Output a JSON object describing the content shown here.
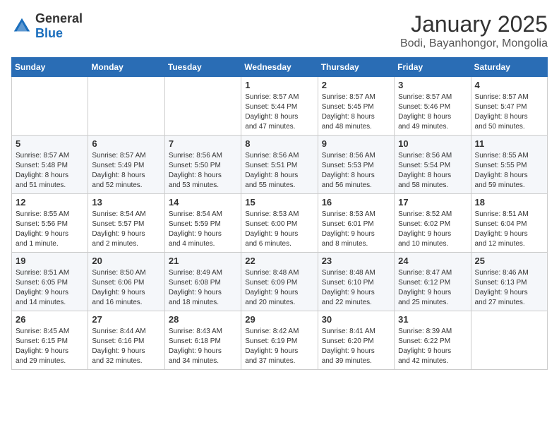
{
  "logo": {
    "general": "General",
    "blue": "Blue"
  },
  "header": {
    "month": "January 2025",
    "location": "Bodi, Bayanhongor, Mongolia"
  },
  "weekdays": [
    "Sunday",
    "Monday",
    "Tuesday",
    "Wednesday",
    "Thursday",
    "Friday",
    "Saturday"
  ],
  "weeks": [
    [
      {
        "day": "",
        "info": ""
      },
      {
        "day": "",
        "info": ""
      },
      {
        "day": "",
        "info": ""
      },
      {
        "day": "1",
        "info": "Sunrise: 8:57 AM\nSunset: 5:44 PM\nDaylight: 8 hours\nand 47 minutes."
      },
      {
        "day": "2",
        "info": "Sunrise: 8:57 AM\nSunset: 5:45 PM\nDaylight: 8 hours\nand 48 minutes."
      },
      {
        "day": "3",
        "info": "Sunrise: 8:57 AM\nSunset: 5:46 PM\nDaylight: 8 hours\nand 49 minutes."
      },
      {
        "day": "4",
        "info": "Sunrise: 8:57 AM\nSunset: 5:47 PM\nDaylight: 8 hours\nand 50 minutes."
      }
    ],
    [
      {
        "day": "5",
        "info": "Sunrise: 8:57 AM\nSunset: 5:48 PM\nDaylight: 8 hours\nand 51 minutes."
      },
      {
        "day": "6",
        "info": "Sunrise: 8:57 AM\nSunset: 5:49 PM\nDaylight: 8 hours\nand 52 minutes."
      },
      {
        "day": "7",
        "info": "Sunrise: 8:56 AM\nSunset: 5:50 PM\nDaylight: 8 hours\nand 53 minutes."
      },
      {
        "day": "8",
        "info": "Sunrise: 8:56 AM\nSunset: 5:51 PM\nDaylight: 8 hours\nand 55 minutes."
      },
      {
        "day": "9",
        "info": "Sunrise: 8:56 AM\nSunset: 5:53 PM\nDaylight: 8 hours\nand 56 minutes."
      },
      {
        "day": "10",
        "info": "Sunrise: 8:56 AM\nSunset: 5:54 PM\nDaylight: 8 hours\nand 58 minutes."
      },
      {
        "day": "11",
        "info": "Sunrise: 8:55 AM\nSunset: 5:55 PM\nDaylight: 8 hours\nand 59 minutes."
      }
    ],
    [
      {
        "day": "12",
        "info": "Sunrise: 8:55 AM\nSunset: 5:56 PM\nDaylight: 9 hours\nand 1 minute."
      },
      {
        "day": "13",
        "info": "Sunrise: 8:54 AM\nSunset: 5:57 PM\nDaylight: 9 hours\nand 2 minutes."
      },
      {
        "day": "14",
        "info": "Sunrise: 8:54 AM\nSunset: 5:59 PM\nDaylight: 9 hours\nand 4 minutes."
      },
      {
        "day": "15",
        "info": "Sunrise: 8:53 AM\nSunset: 6:00 PM\nDaylight: 9 hours\nand 6 minutes."
      },
      {
        "day": "16",
        "info": "Sunrise: 8:53 AM\nSunset: 6:01 PM\nDaylight: 9 hours\nand 8 minutes."
      },
      {
        "day": "17",
        "info": "Sunrise: 8:52 AM\nSunset: 6:02 PM\nDaylight: 9 hours\nand 10 minutes."
      },
      {
        "day": "18",
        "info": "Sunrise: 8:51 AM\nSunset: 6:04 PM\nDaylight: 9 hours\nand 12 minutes."
      }
    ],
    [
      {
        "day": "19",
        "info": "Sunrise: 8:51 AM\nSunset: 6:05 PM\nDaylight: 9 hours\nand 14 minutes."
      },
      {
        "day": "20",
        "info": "Sunrise: 8:50 AM\nSunset: 6:06 PM\nDaylight: 9 hours\nand 16 minutes."
      },
      {
        "day": "21",
        "info": "Sunrise: 8:49 AM\nSunset: 6:08 PM\nDaylight: 9 hours\nand 18 minutes."
      },
      {
        "day": "22",
        "info": "Sunrise: 8:48 AM\nSunset: 6:09 PM\nDaylight: 9 hours\nand 20 minutes."
      },
      {
        "day": "23",
        "info": "Sunrise: 8:48 AM\nSunset: 6:10 PM\nDaylight: 9 hours\nand 22 minutes."
      },
      {
        "day": "24",
        "info": "Sunrise: 8:47 AM\nSunset: 6:12 PM\nDaylight: 9 hours\nand 25 minutes."
      },
      {
        "day": "25",
        "info": "Sunrise: 8:46 AM\nSunset: 6:13 PM\nDaylight: 9 hours\nand 27 minutes."
      }
    ],
    [
      {
        "day": "26",
        "info": "Sunrise: 8:45 AM\nSunset: 6:15 PM\nDaylight: 9 hours\nand 29 minutes."
      },
      {
        "day": "27",
        "info": "Sunrise: 8:44 AM\nSunset: 6:16 PM\nDaylight: 9 hours\nand 32 minutes."
      },
      {
        "day": "28",
        "info": "Sunrise: 8:43 AM\nSunset: 6:18 PM\nDaylight: 9 hours\nand 34 minutes."
      },
      {
        "day": "29",
        "info": "Sunrise: 8:42 AM\nSunset: 6:19 PM\nDaylight: 9 hours\nand 37 minutes."
      },
      {
        "day": "30",
        "info": "Sunrise: 8:41 AM\nSunset: 6:20 PM\nDaylight: 9 hours\nand 39 minutes."
      },
      {
        "day": "31",
        "info": "Sunrise: 8:39 AM\nSunset: 6:22 PM\nDaylight: 9 hours\nand 42 minutes."
      },
      {
        "day": "",
        "info": ""
      }
    ]
  ]
}
